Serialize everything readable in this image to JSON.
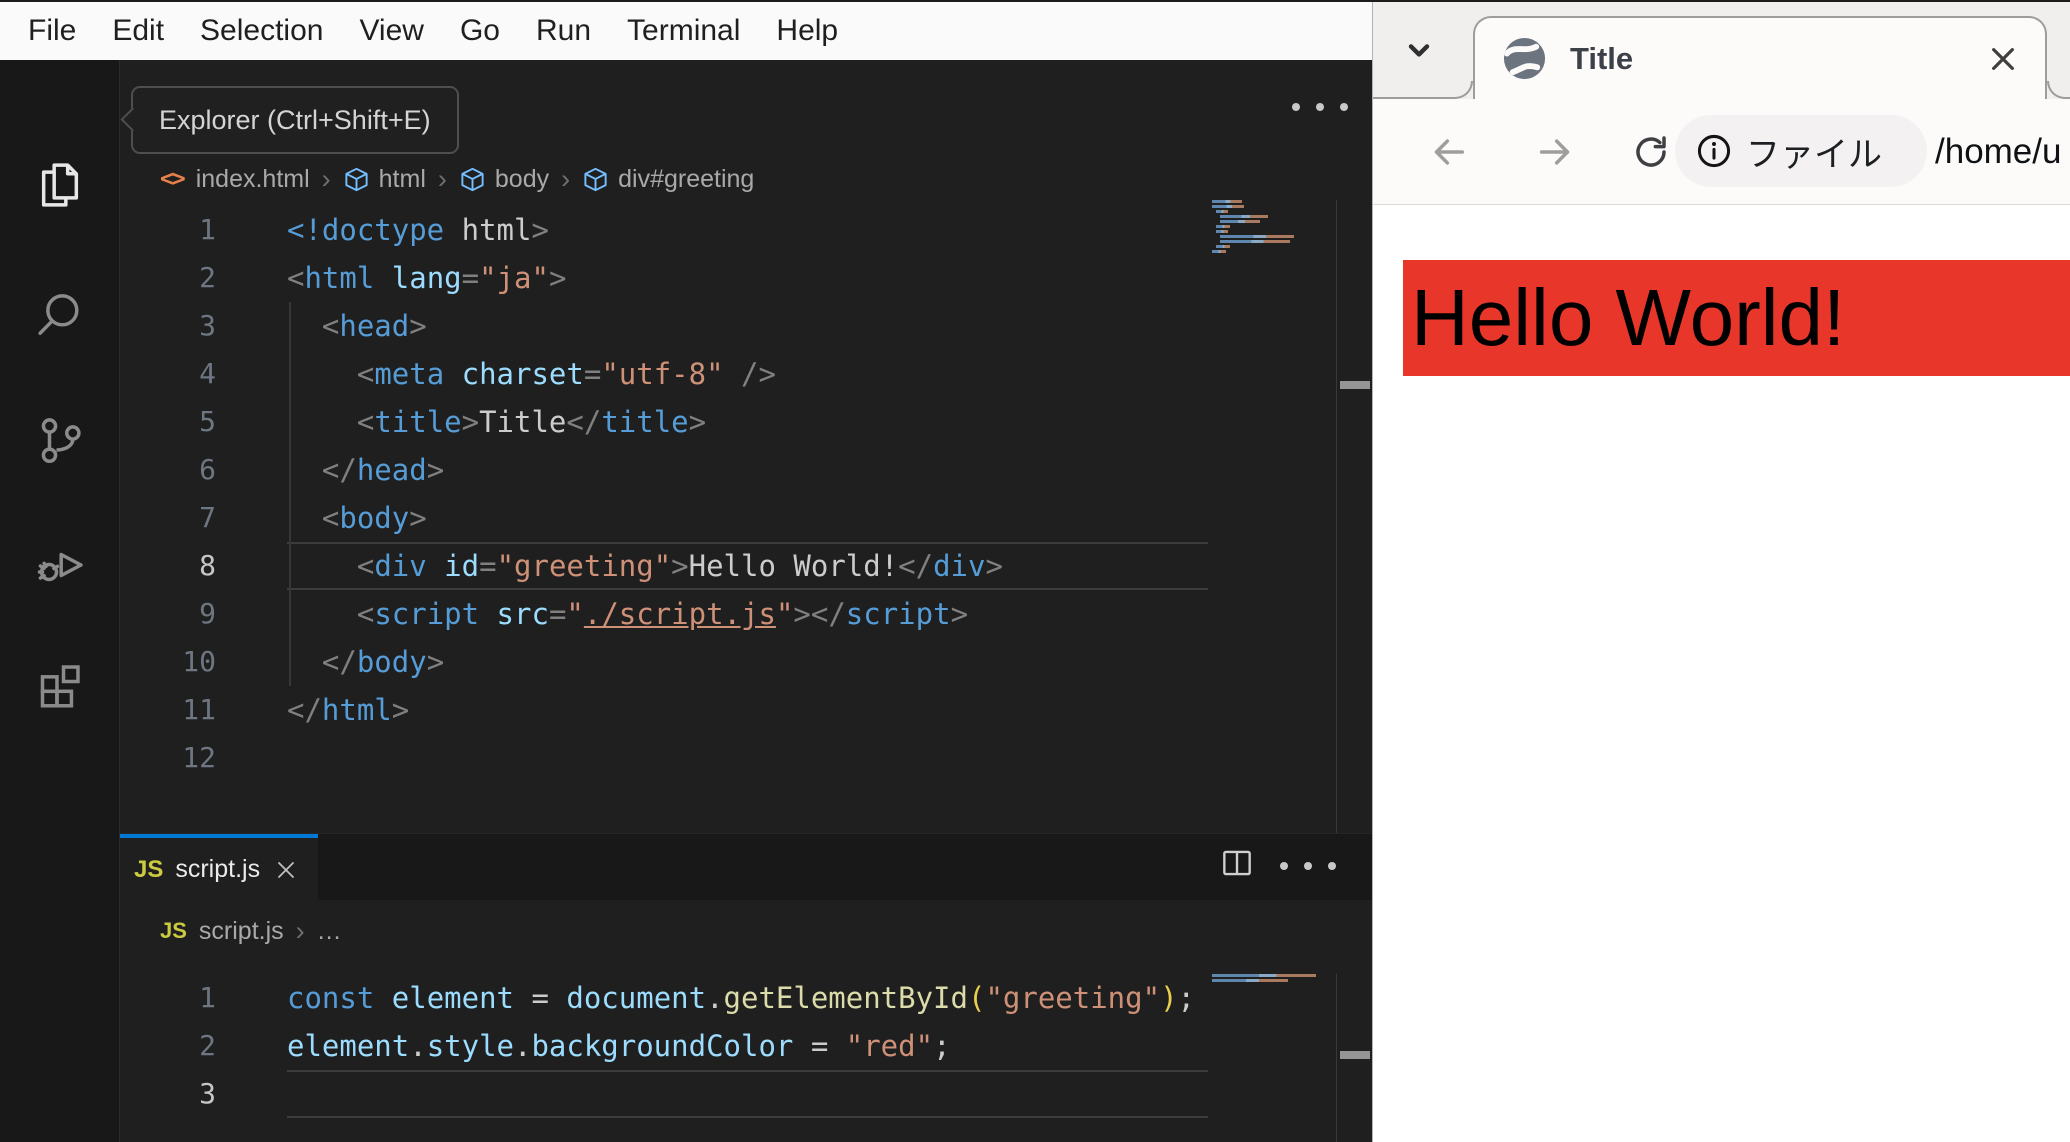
{
  "window": {
    "menu_items": [
      "File",
      "Edit",
      "Selection",
      "View",
      "Go",
      "Run",
      "Terminal",
      "Help"
    ]
  },
  "activity_bar": {
    "icons": [
      "explorer-icon",
      "search-icon",
      "source-control-icon",
      "run-debug-icon",
      "extensions-icon"
    ],
    "tooltip": "Explorer (Ctrl+Shift+E)"
  },
  "editor": {
    "breadcrumb": {
      "file": "index.html",
      "nodes": [
        "html",
        "body",
        "div#greeting"
      ],
      "separator": "›"
    },
    "active_line": 8,
    "lines": [
      [
        [
          "tag",
          "<!doctype"
        ],
        [
          "pln",
          " "
        ],
        [
          "txt",
          "html"
        ],
        [
          "pun",
          ">"
        ]
      ],
      [
        [
          "pun",
          "<"
        ],
        [
          "tag",
          "html"
        ],
        [
          "pln",
          " "
        ],
        [
          "attr",
          "lang"
        ],
        [
          "pun",
          "="
        ],
        [
          "str",
          "\"ja\""
        ],
        [
          "pun",
          ">"
        ]
      ],
      [
        [
          "pln",
          "  "
        ],
        [
          "pun",
          "<"
        ],
        [
          "tag",
          "head"
        ],
        [
          "pun",
          ">"
        ]
      ],
      [
        [
          "pln",
          "    "
        ],
        [
          "pun",
          "<"
        ],
        [
          "tag",
          "meta"
        ],
        [
          "pln",
          " "
        ],
        [
          "attr",
          "charset"
        ],
        [
          "pun",
          "="
        ],
        [
          "str",
          "\"utf-8\""
        ],
        [
          "pln",
          " "
        ],
        [
          "pun",
          "/>"
        ]
      ],
      [
        [
          "pln",
          "    "
        ],
        [
          "pun",
          "<"
        ],
        [
          "tag",
          "title"
        ],
        [
          "pun",
          ">"
        ],
        [
          "txt",
          "Title"
        ],
        [
          "pun",
          "</"
        ],
        [
          "tag",
          "title"
        ],
        [
          "pun",
          ">"
        ]
      ],
      [
        [
          "pln",
          "  "
        ],
        [
          "pun",
          "</"
        ],
        [
          "tag",
          "head"
        ],
        [
          "pun",
          ">"
        ]
      ],
      [
        [
          "pln",
          "  "
        ],
        [
          "pun",
          "<"
        ],
        [
          "tag",
          "body"
        ],
        [
          "pun",
          ">"
        ]
      ],
      [
        [
          "pln",
          "    "
        ],
        [
          "pun",
          "<"
        ],
        [
          "tag",
          "div"
        ],
        [
          "pln",
          " "
        ],
        [
          "attr",
          "id"
        ],
        [
          "pun",
          "="
        ],
        [
          "str",
          "\"greeting\""
        ],
        [
          "pun",
          ">"
        ],
        [
          "txt",
          "Hello World!"
        ],
        [
          "pun",
          "</"
        ],
        [
          "tag",
          "div"
        ],
        [
          "pun",
          ">"
        ]
      ],
      [
        [
          "pln",
          "    "
        ],
        [
          "pun",
          "<"
        ],
        [
          "tag",
          "script"
        ],
        [
          "pln",
          " "
        ],
        [
          "attr",
          "src"
        ],
        [
          "pun",
          "="
        ],
        [
          "str",
          "\""
        ],
        [
          "lnk",
          "./script.js"
        ],
        [
          "str",
          "\""
        ],
        [
          "pun",
          ">"
        ],
        [
          "pun",
          "</"
        ],
        [
          "tag",
          "script"
        ],
        [
          "pun",
          ">"
        ]
      ],
      [
        [
          "pln",
          "  "
        ],
        [
          "pun",
          "</"
        ],
        [
          "tag",
          "body"
        ],
        [
          "pun",
          ">"
        ]
      ],
      [
        [
          "pun",
          "</"
        ],
        [
          "tag",
          "html"
        ],
        [
          "pun",
          ">"
        ]
      ],
      []
    ]
  },
  "panel": {
    "tab": {
      "badge": "JS",
      "label": "script.js"
    },
    "breadcrumb": {
      "badge": "JS",
      "file": "script.js",
      "separator": "›",
      "more": "…"
    },
    "active_line": 3,
    "lines": [
      [
        [
          "kw",
          "const"
        ],
        [
          "pln",
          " "
        ],
        [
          "attr",
          "element"
        ],
        [
          "pln",
          " = "
        ],
        [
          "attr",
          "document"
        ],
        [
          "pln",
          "."
        ],
        [
          "fn",
          "getElementById"
        ],
        [
          "par",
          "("
        ],
        [
          "str",
          "\"greeting\""
        ],
        [
          "par",
          ")"
        ],
        [
          "pln",
          ";"
        ]
      ],
      [
        [
          "attr",
          "element"
        ],
        [
          "pln",
          "."
        ],
        [
          "attr",
          "style"
        ],
        [
          "pln",
          "."
        ],
        [
          "attr",
          "backgroundColor"
        ],
        [
          "pln",
          " = "
        ],
        [
          "str",
          "\"red\""
        ],
        [
          "pln",
          ";"
        ]
      ],
      []
    ]
  },
  "browser": {
    "tab": {
      "title": "Title"
    },
    "toolbar": {
      "chip_label": "ファイル",
      "url": "/home/u"
    },
    "page": {
      "heading": "Hello World!"
    }
  },
  "colors": {
    "accent_tab_border": "#0078d4",
    "banner_red": "#e8372a",
    "menu_bar_bg": "#fbfafa",
    "editor_bg": "#1f1f1f",
    "activity_bar_bg": "#181818",
    "syntax": {
      "tag": "#569cd6",
      "attribute": "#9cdcfe",
      "string": "#ce9178",
      "text": "#cccccc",
      "punctuation": "#808080",
      "keyword": "#569cd6",
      "function": "#dcdcaa",
      "bracket": "#e9cf4e",
      "link": "#ce9178",
      "line_number": "#6e7681",
      "active_line_number": "#c6c6c6"
    }
  }
}
